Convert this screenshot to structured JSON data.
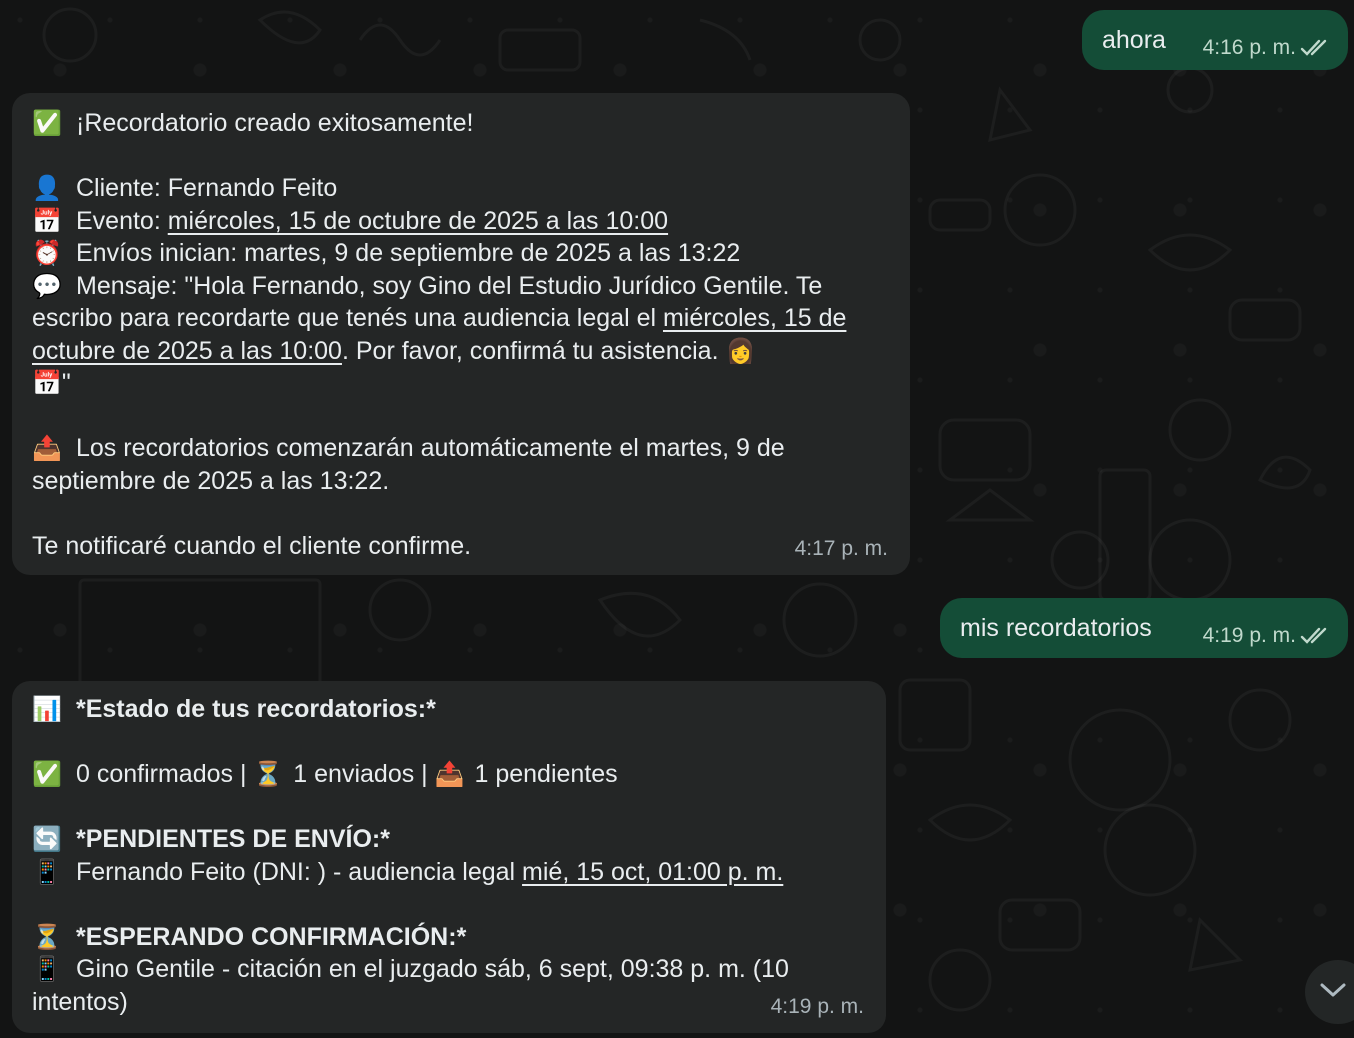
{
  "messages": {
    "m1": {
      "text": "ahora",
      "time": "4:16 p. m."
    },
    "m2": {
      "title": "¡Recordatorio creado exitosamente!",
      "cliente": "Cliente: Fernando Feito",
      "evento_label": "Evento: ",
      "evento_date": "miércoles, 15 de octubre de 2025 a las 10:00",
      "envios": "Envíos inician: martes, 9 de septiembre de 2025 a las 13:22",
      "mensaje_a": "Mensaje: \"Hola Fernando, soy Gino del Estudio Jurídico Gentile. Te escribo para recordarte que tenés una audiencia legal el ",
      "mensaje_date": "miércoles, 15 de octubre de 2025 a las 10:00",
      "mensaje_b": ". Por favor, confirmá tu asistencia. ",
      "mensaje_end": "\"",
      "auto": "Los recordatorios comenzarán automáticamente el martes, 9 de septiembre de 2025 a las 13:22.",
      "notify": "Te notificaré cuando el cliente confirme.",
      "time": "4:17 p. m."
    },
    "m3": {
      "text": "mis recordatorios",
      "time": "4:19 p. m."
    },
    "m4": {
      "title": "*Estado de tus recordatorios:*",
      "confirmados": "0 confirmados | ",
      "enviados": "1 enviados | ",
      "pendientes": "1 pendientes",
      "pend_title": "*PENDIENTES DE ENVÍO:*",
      "pend_item": "Fernando Feito (DNI: ) - audiencia legal ",
      "pend_date": "mié, 15 oct, 01:00 p. m.",
      "esp_title": "*ESPERANDO CONFIRMACIÓN:*",
      "esp_item": "Gino Gentile - citación en el juzgado sáb, 6 sept, 09:38 p. m. (10 intentos)",
      "time": "4:19 p. m."
    }
  },
  "icons": {
    "check_mark": "✅",
    "person": "👤",
    "calendar": "📅",
    "alarm": "⏰",
    "speech": "💬",
    "woman": "👩",
    "outbox": "📤",
    "chart": "📊",
    "hourglass": "⏳",
    "refresh": "🔄",
    "phone": "📱"
  },
  "colors": {
    "background": "#121313",
    "incoming_bubble": "#242626",
    "outgoing_bubble": "#144d37",
    "text": "#e9edef",
    "meta": "#a9b3b8"
  }
}
